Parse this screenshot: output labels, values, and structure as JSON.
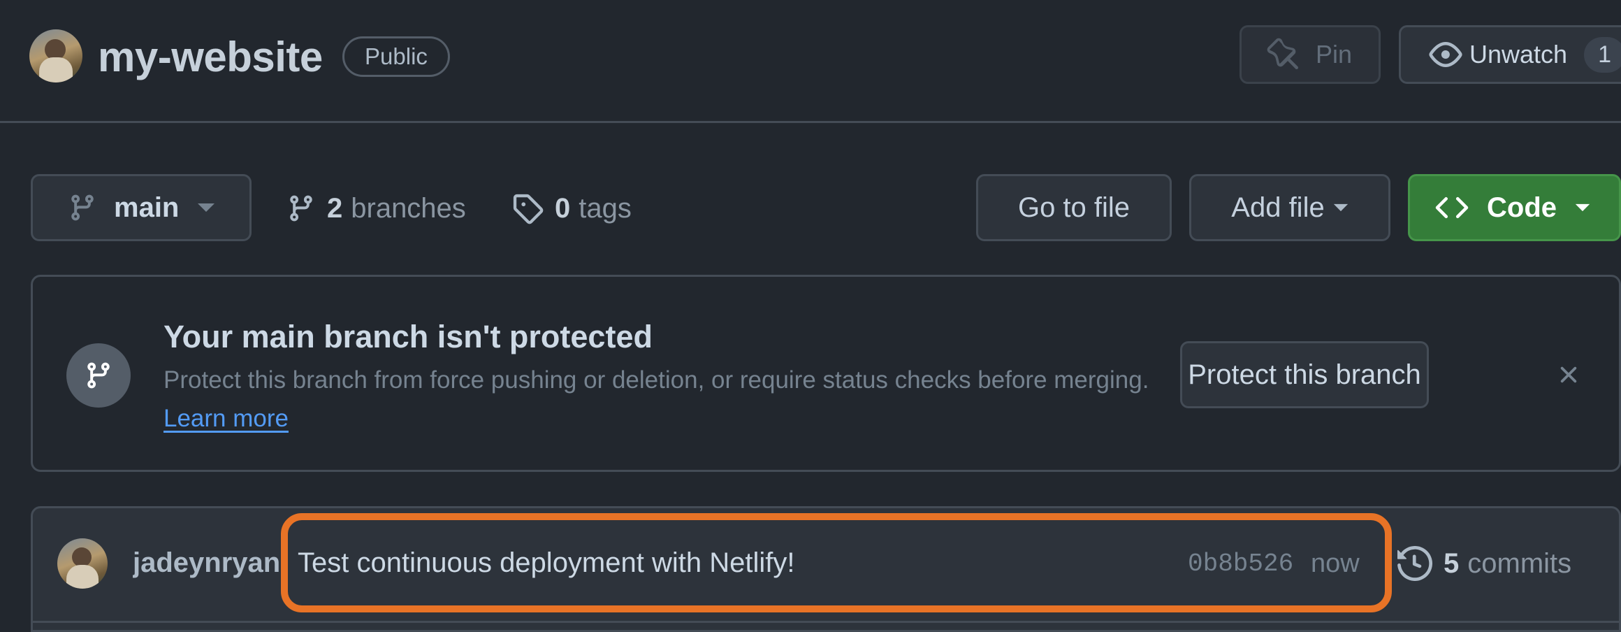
{
  "header": {
    "repo_name": "my-website",
    "visibility": "Public",
    "pin_label": "Pin",
    "unwatch_label": "Unwatch",
    "watch_count": "1"
  },
  "toolbar": {
    "branch_name": "main",
    "branches_count": "2",
    "branches_label": "branches",
    "tags_count": "0",
    "tags_label": "tags",
    "go_to_file": "Go to file",
    "add_file": "Add file",
    "code": "Code"
  },
  "protection_banner": {
    "title": "Your main branch isn't protected",
    "description": "Protect this branch from force pushing or deletion, or require status checks before merging.",
    "learn_more": "Learn more",
    "button": "Protect this branch"
  },
  "latest_commit": {
    "author": "jadeynryan",
    "message": "Test continuous deployment with Netlify!",
    "sha": "0b8b526",
    "time": "now",
    "commits_count": "5",
    "commits_label": "commits"
  },
  "icons": [
    "avatar",
    "pin-icon",
    "eye-icon",
    "git-branch-icon",
    "caret-down-icon",
    "tag-icon",
    "code-icon",
    "close-icon",
    "history-icon"
  ],
  "colors": {
    "background": "#22272e",
    "button": "#2d333b",
    "border": "#444c56",
    "code_button": "#347d39",
    "link": "#539bf5",
    "highlight": "#e87326"
  }
}
